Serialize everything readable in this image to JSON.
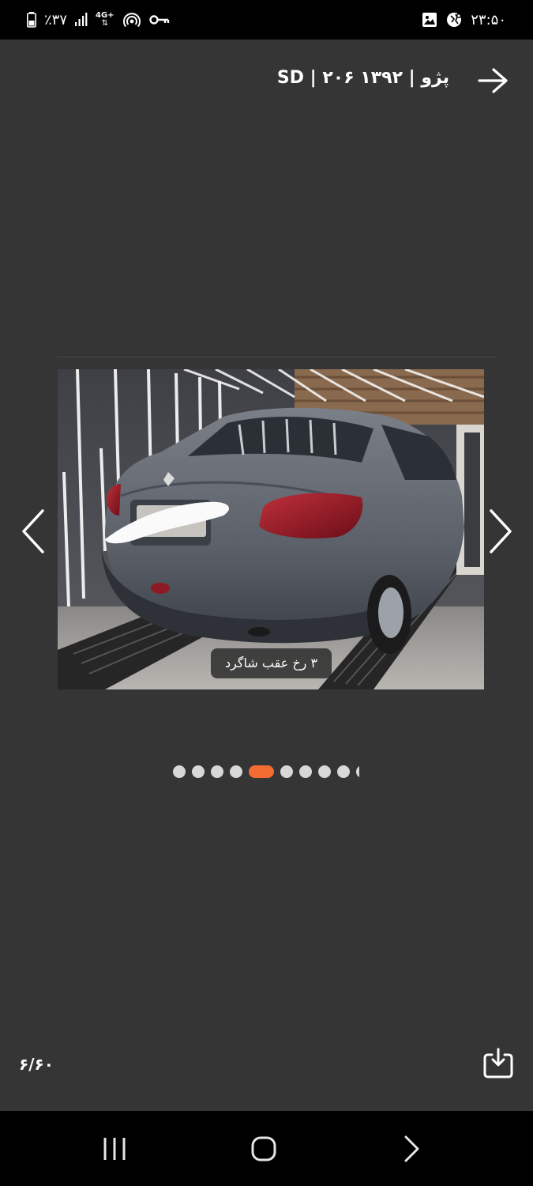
{
  "status_bar": {
    "battery": "٪۳۷",
    "network": "4G+",
    "time": "۲۳:۵۰"
  },
  "header": {
    "title": "SD | ۲۰۶ ۱۳۹۲ | پژو"
  },
  "gallery": {
    "caption": "۳ رخ عقب شاگرد",
    "counter": "۶/۶۰",
    "dots_visible": 10,
    "active_dot_index": 4
  },
  "icons": {
    "back": "arrow-right-icon",
    "prev": "chevron-left-icon",
    "next": "chevron-right-icon",
    "download": "download-icon",
    "recents": "recents-icon",
    "home": "home-icon",
    "system_back": "system-back-icon"
  },
  "colors": {
    "background": "#353535",
    "active_dot": "#f26c32",
    "inactive_dot": "#d8d8d8"
  }
}
